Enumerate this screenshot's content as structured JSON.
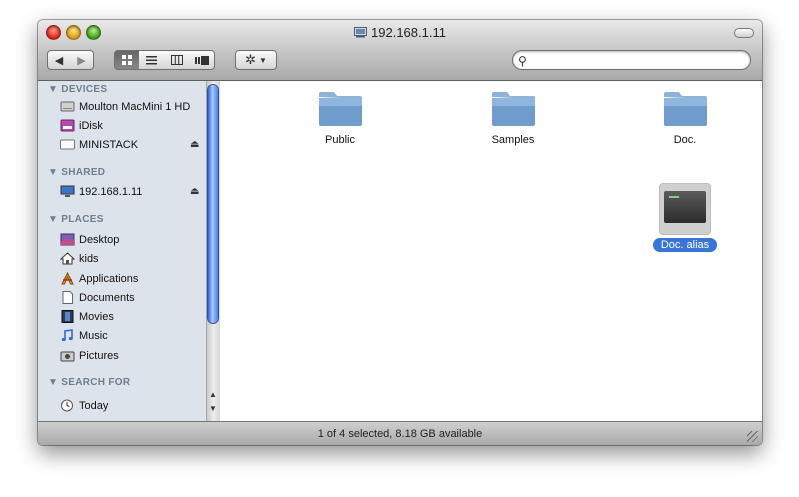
{
  "window": {
    "title": "192.168.1.11"
  },
  "toolbar": {
    "back_icon": "back-arrow-icon",
    "forward_icon": "forward-arrow-icon",
    "view_modes": [
      "icon-view",
      "list-view",
      "column-view",
      "coverflow-view"
    ],
    "action_icon": "gear-icon",
    "search": {
      "value": "",
      "placeholder": ""
    }
  },
  "sidebar": {
    "sections": [
      {
        "title": "DEVICES",
        "items": [
          "Moulton MacMini 1 HD",
          "iDisk",
          "MINISTACK"
        ]
      },
      {
        "title": "SHARED",
        "items": [
          "192.168.1.11"
        ]
      },
      {
        "title": "PLACES",
        "items": [
          "Desktop",
          "kids",
          "Applications",
          "Documents",
          "Movies",
          "Music",
          "Pictures"
        ]
      },
      {
        "title": "SEARCH FOR",
        "items": [
          "Today"
        ]
      }
    ]
  },
  "files": [
    {
      "name": "Public",
      "icon": "folder-icon",
      "selected": false
    },
    {
      "name": "Samples",
      "icon": "folder-icon",
      "selected": false
    },
    {
      "name": "Doc.",
      "icon": "folder-icon",
      "selected": false
    },
    {
      "name": "Doc. alias",
      "icon": "terminal-alias-icon",
      "selected": true
    }
  ],
  "status": {
    "text": "1 of 4 selected, 8.18 GB available"
  },
  "colors": {
    "selection": "#3875d7",
    "sidebar_bg": "#dde3ea",
    "section_header": "#6f7d8c"
  }
}
